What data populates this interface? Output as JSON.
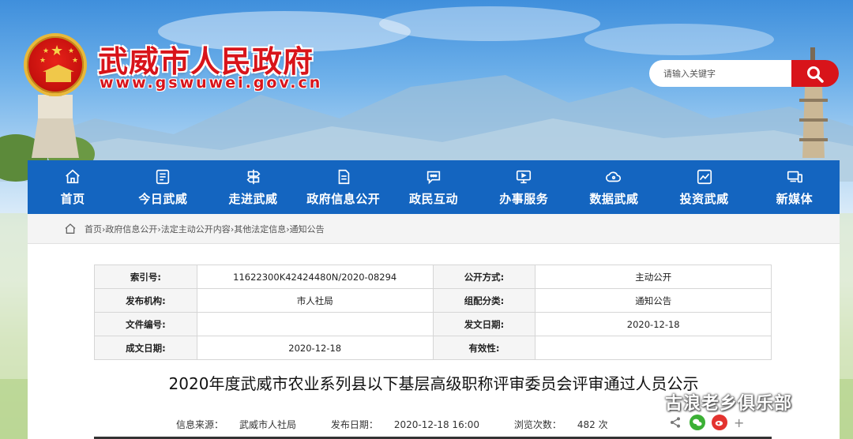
{
  "header": {
    "site_title": "武威市人民政府",
    "site_url": "www.gswuwei.gov.cn",
    "search_placeholder": "请输入关键字"
  },
  "nav": {
    "items": [
      {
        "label": "首页",
        "icon": "home-icon"
      },
      {
        "label": "今日武威",
        "icon": "news-icon"
      },
      {
        "label": "走进武威",
        "icon": "signpost-icon"
      },
      {
        "label": "政府信息公开",
        "icon": "document-icon"
      },
      {
        "label": "政民互动",
        "icon": "chat-icon"
      },
      {
        "label": "办事服务",
        "icon": "monitor-icon"
      },
      {
        "label": "数据武威",
        "icon": "cloud-icon"
      },
      {
        "label": "投资武威",
        "icon": "chart-icon"
      },
      {
        "label": "新媒体",
        "icon": "devices-icon"
      }
    ]
  },
  "breadcrumb": {
    "items": [
      "首页",
      "政府信息公开",
      "法定主动公开内容",
      "其他法定信息",
      "通知公告"
    ],
    "separator": "›"
  },
  "meta": {
    "rows": [
      [
        {
          "k": "索引号:",
          "v": "11622300K42424480N/2020-08294"
        },
        {
          "k": "公开方式:",
          "v": "主动公开"
        }
      ],
      [
        {
          "k": "发布机构:",
          "v": "市人社局"
        },
        {
          "k": "组配分类:",
          "v": "通知公告"
        }
      ],
      [
        {
          "k": "文件编号:",
          "v": ""
        },
        {
          "k": "发文日期:",
          "v": "2020-12-18"
        }
      ],
      [
        {
          "k": "成文日期:",
          "v": "2020-12-18"
        },
        {
          "k": "有效性:",
          "v": ""
        }
      ]
    ]
  },
  "article": {
    "title": "2020年度武威市农业系列县以下基层高级职称评审委员会评审通过人员公示",
    "source_label": "信息来源：",
    "source": "武威市人社局",
    "date_label": "发布日期：",
    "date": "2020-12-18 16:00",
    "views_label": "浏览次数：",
    "views": "482 次"
  },
  "watermark": {
    "text": "古浪老乡俱乐部"
  },
  "colors": {
    "brand_red": "#d8141a",
    "nav_blue": "#1465c0"
  }
}
